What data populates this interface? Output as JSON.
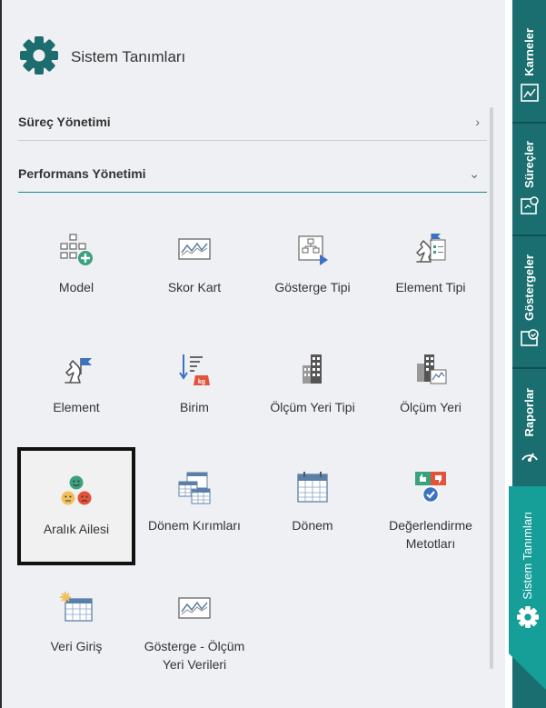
{
  "header": {
    "title": "Sistem Tanımları",
    "icon": "gear-icon"
  },
  "sections": [
    {
      "label": "Süreç Yönetimi",
      "state": "collapsed"
    },
    {
      "label": "Performans Yönetimi",
      "state": "expanded"
    }
  ],
  "tiles": [
    {
      "label": "Model",
      "icon": "model-icon"
    },
    {
      "label": "Skor Kart",
      "icon": "score-card-icon"
    },
    {
      "label": "Gösterge Tipi",
      "icon": "indicator-type-icon"
    },
    {
      "label": "Element Tipi",
      "icon": "element-type-icon"
    },
    {
      "label": "Element",
      "icon": "element-icon"
    },
    {
      "label": "Birim",
      "icon": "unit-icon"
    },
    {
      "label": "Ölçüm Yeri Tipi",
      "icon": "measurement-location-type-icon"
    },
    {
      "label": "Ölçüm Yeri",
      "icon": "measurement-location-icon"
    },
    {
      "label": "Aralık Ailesi",
      "icon": "range-family-icon",
      "selected": true
    },
    {
      "label": "Dönem Kırımları",
      "icon": "period-breakdown-icon"
    },
    {
      "label": "Dönem",
      "icon": "period-icon"
    },
    {
      "label": "Değerlendirme Metotları",
      "icon": "evaluation-methods-icon"
    },
    {
      "label": "Veri Giriş",
      "icon": "data-entry-icon"
    },
    {
      "label": "Gösterge - Ölçüm Yeri Verileri",
      "icon": "indicator-location-data-icon"
    }
  ],
  "rail": {
    "tabs": [
      {
        "label": "Karneler",
        "icon": "scorecards-icon"
      },
      {
        "label": "Süreçler",
        "icon": "processes-icon"
      },
      {
        "label": "Göstergeler",
        "icon": "indicators-icon"
      },
      {
        "label": "Raporlar",
        "icon": "reports-icon"
      },
      {
        "label": "Sistem Tanımları",
        "icon": "gear-icon",
        "active": true
      }
    ]
  },
  "colors": {
    "accent": "#1b8b86",
    "rail": "#1b6e70",
    "rail_active": "#169e98",
    "panel_bg": "#eef0f3"
  }
}
